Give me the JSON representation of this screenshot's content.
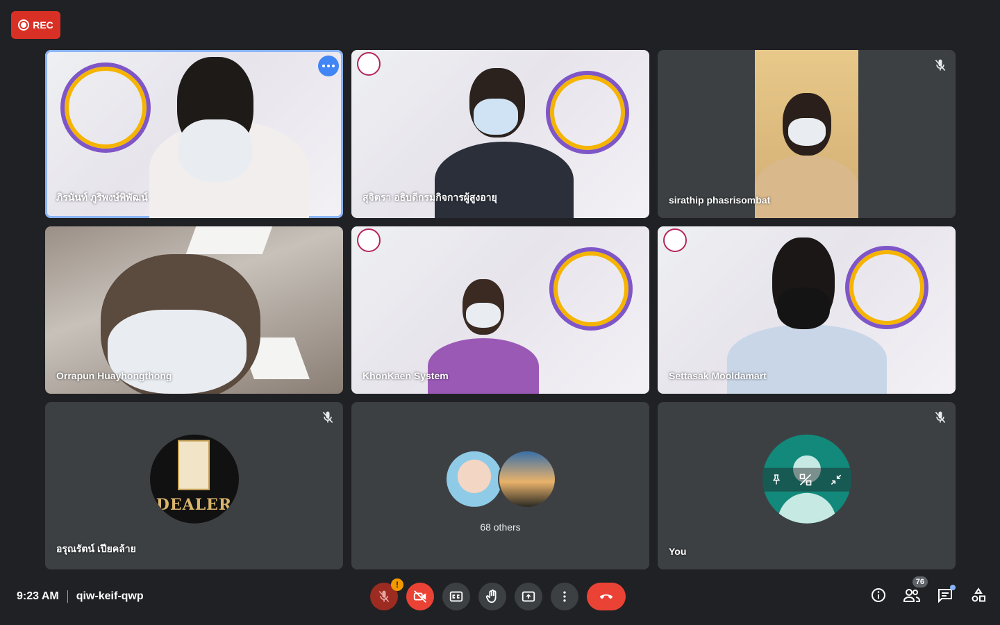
{
  "recording": {
    "label": "REC"
  },
  "tiles": [
    {
      "name": "ภิรนันท์ ภูริพงษ์พิพัฒน์",
      "muted": false,
      "active": true
    },
    {
      "name": "สุจิตรา อธิบดีกรมกิจการผู้สูงอายุ",
      "muted": false
    },
    {
      "name": "sirathip phasrisombat",
      "muted": true
    },
    {
      "name": "Orrapun Huayhongthong",
      "muted": false
    },
    {
      "name": "KhonKaen System",
      "muted": false
    },
    {
      "name": "Settasak Mooldamart",
      "muted": true
    },
    {
      "name": "อรุณรัตน์ เปียคล้าย",
      "muted": true,
      "avatar_text": "DEALER"
    },
    {
      "label": "68 others"
    },
    {
      "name": "You",
      "muted": true
    }
  ],
  "meeting": {
    "time": "9:23 AM",
    "code": "qiw-keif-qwp"
  },
  "controls": {
    "mic_warning": "!",
    "people_count": "76"
  },
  "colors": {
    "end_call": "#ea4335",
    "accent": "#8ab4f8",
    "rec": "#d93025",
    "you_avatar": "#12897a"
  },
  "icons": [
    "record-icon",
    "more-options-icon",
    "mic-off-icon",
    "camera-off-icon",
    "captions-icon",
    "raise-hand-icon",
    "present-icon",
    "more-vert-icon",
    "end-call-icon",
    "info-icon",
    "people-icon",
    "chat-icon",
    "activities-icon",
    "pin-icon",
    "mirror-icon",
    "minimize-icon"
  ]
}
